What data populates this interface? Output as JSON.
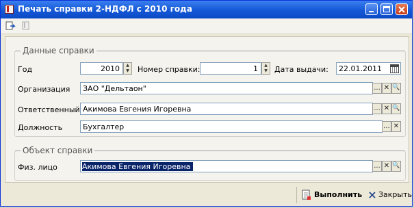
{
  "window": {
    "title": "Печать справки 2-НДФЛ с 2010 года"
  },
  "groups": {
    "data": {
      "legend": "Данные справки"
    },
    "object": {
      "legend": "Объект справки"
    }
  },
  "fields": {
    "year": {
      "label": "Год",
      "value": "2010"
    },
    "number": {
      "label": "Номер справки:",
      "value": "1"
    },
    "date": {
      "label": "Дата выдачи:",
      "value": "22.01.2011"
    },
    "organization": {
      "label": "Организация",
      "value": "ЗАО \"Дельтаон\""
    },
    "responsible": {
      "label": "Ответственный",
      "value": "Акимова Евгения Игоревна"
    },
    "position": {
      "label": "Должность",
      "value": "Бухгалтер"
    },
    "person": {
      "label": "Физ. лицо",
      "value": "Акимова Евгения Игоревна"
    }
  },
  "buttons": {
    "choose": "...",
    "clear": "✕",
    "open": "🔍",
    "execute": "Выполнить",
    "close": "Закрыть"
  }
}
